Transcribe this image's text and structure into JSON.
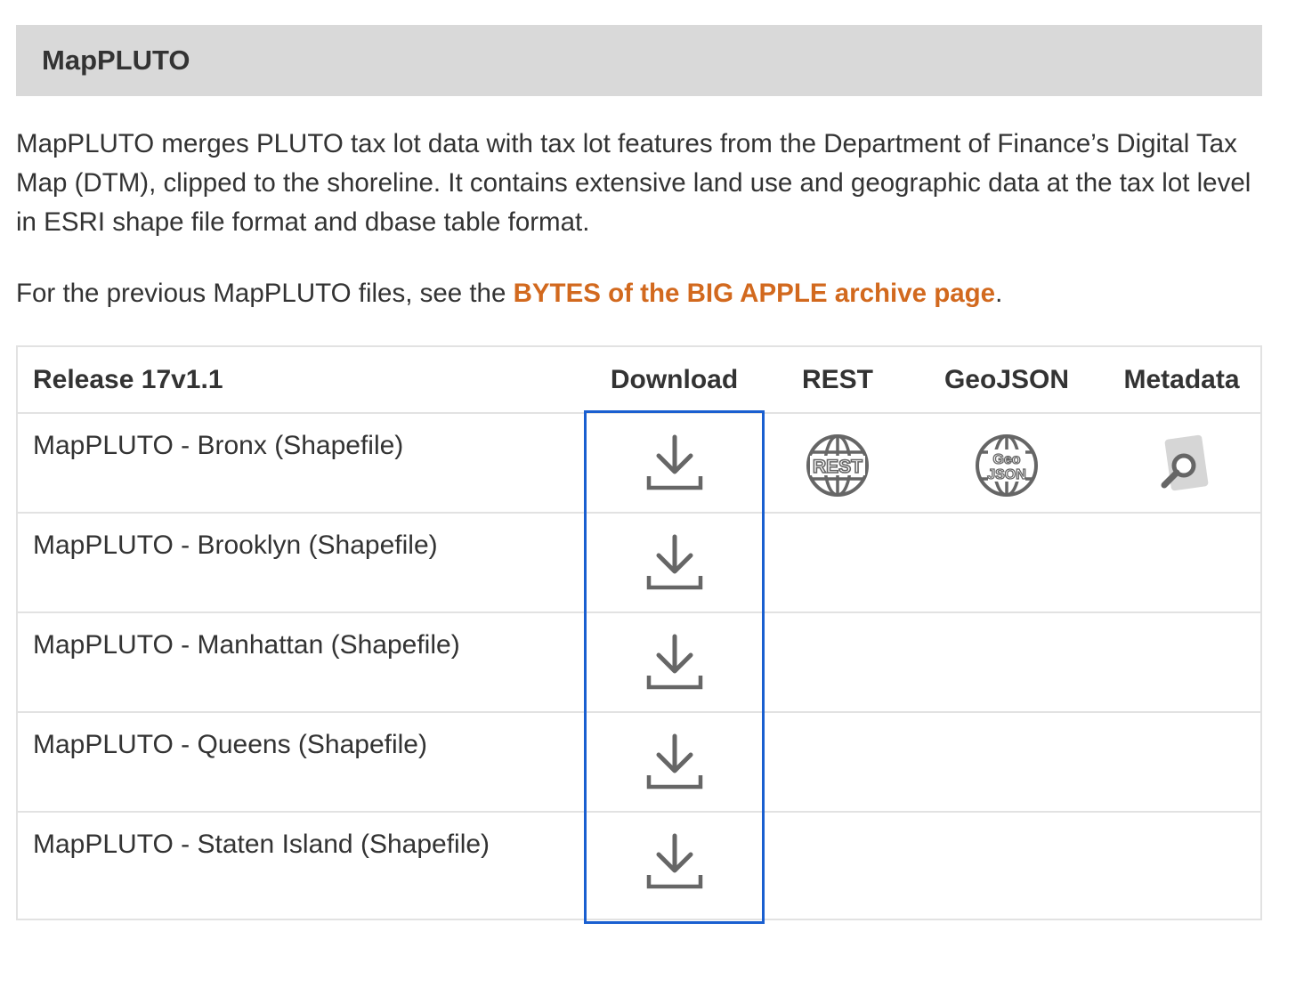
{
  "section": {
    "title": "MapPLUTO"
  },
  "intro": {
    "text": "MapPLUTO merges PLUTO tax lot data with tax lot features from the Department of Finance’s Digital Tax Map (DTM), clipped to the shoreline. It contains extensive land use and geographic data at the tax lot level in ESRI shape file format and dbase table format."
  },
  "archive": {
    "prefix": "For the previous MapPLUTO files, see the ",
    "link_label": "BYTES of the BIG APPLE archive page",
    "suffix": "."
  },
  "table": {
    "headers": {
      "release": "Release 17v1.1",
      "download": "Download",
      "rest": "REST",
      "geojson": "GeoJSON",
      "metadata": "Metadata"
    },
    "rows": [
      {
        "name": "MapPLUTO - Bronx (Shapefile)"
      },
      {
        "name": "MapPLUTO - Brooklyn (Shapefile)"
      },
      {
        "name": "MapPLUTO - Manhattan (Shapefile)"
      },
      {
        "name": "MapPLUTO - Queens (Shapefile)"
      },
      {
        "name": "MapPLUTO - Staten Island (Shapefile)"
      }
    ],
    "icons": {
      "download": "download-icon",
      "rest": "rest-globe-icon",
      "geojson": "geojson-globe-icon",
      "metadata": "metadata-magnifier-icon"
    },
    "globe_labels": {
      "rest": "REST",
      "geojson_top": "Geo",
      "geojson_bottom": "JSON"
    }
  },
  "colors": {
    "header_bg": "#d9d9d9",
    "link": "#d2691e",
    "highlight": "#1a5fd0",
    "icon": "#666666"
  }
}
